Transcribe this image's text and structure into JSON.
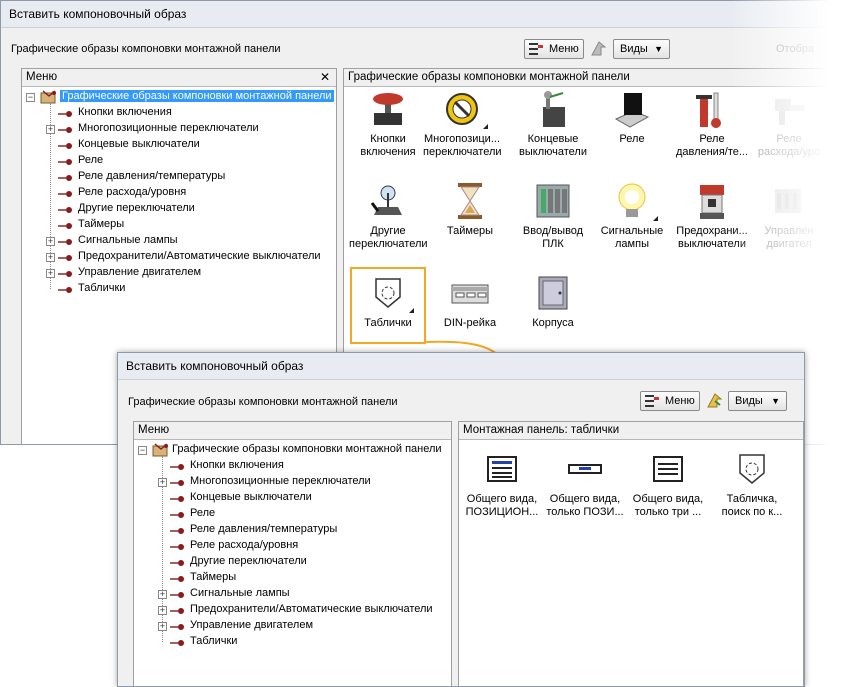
{
  "win1": {
    "title": "Вставить компоновочный образ",
    "subheading": "Графические образы компоновки монтажной панели",
    "menu_button": "Меню",
    "views_button": "Виды",
    "display_label": "Отобра",
    "menu_panel_title": "Меню",
    "content_title": "Графические образы компоновки монтажной панели",
    "tree_root": "Графические образы компоновки монтажной панели",
    "tree": [
      "Кнопки включения",
      "Многопозиционные переключатели",
      "Концевые выключатели",
      "Реле",
      "Реле давления/температуры",
      "Реле расхода/уровня",
      "Другие переключатели",
      "Таймеры",
      "Сигнальные лампы",
      "Предохранители/Автоматические выключатели",
      "Управление двигателем",
      "Таблички"
    ],
    "tiles": [
      [
        "Кнопки",
        "включения"
      ],
      [
        "Многопозици...",
        "переключатели"
      ],
      [
        "Концевые",
        "выключатели"
      ],
      [
        "Реле",
        ""
      ],
      [
        "Реле",
        "давления/те..."
      ],
      [
        "Реле",
        "расхода/уро"
      ],
      [
        "Другие",
        "переключатели"
      ],
      [
        "Таймеры",
        ""
      ],
      [
        "Ввод/вывод",
        "ПЛК"
      ],
      [
        "Сигнальные",
        "лампы"
      ],
      [
        "Предохрани...",
        "выключатели"
      ],
      [
        "Управлен",
        "двигател"
      ],
      [
        "Таблички",
        ""
      ],
      [
        "DIN-рейка",
        ""
      ],
      [
        "Корпуса",
        ""
      ]
    ]
  },
  "win2": {
    "title": "Вставить компоновочный образ",
    "subheading": "Графические образы компоновки монтажной панели",
    "menu_button": "Меню",
    "views_button": "Виды",
    "menu_panel_title": "Меню",
    "content_title": "Монтажная панель: таблички",
    "tree_root": "Графические образы компоновки монтажной панели",
    "tree": [
      "Кнопки включения",
      "Многопозиционные переключатели",
      "Концевые выключатели",
      "Реле",
      "Реле давления/температуры",
      "Реле расхода/уровня",
      "Другие переключатели",
      "Таймеры",
      "Сигнальные лампы",
      "Предохранители/Автоматические выключатели",
      "Управление двигателем",
      "Таблички"
    ],
    "tiles": [
      [
        "Общего вида,",
        "ПОЗИЦИОН..."
      ],
      [
        "Общего вида,",
        "только ПОЗИ..."
      ],
      [
        "Общего вида,",
        "только три ..."
      ],
      [
        "Табличка,",
        "поиск по к..."
      ]
    ]
  },
  "colors": {
    "highlight": "#f5a623",
    "selection": "#3399ff",
    "arrow": "#f5a623"
  }
}
